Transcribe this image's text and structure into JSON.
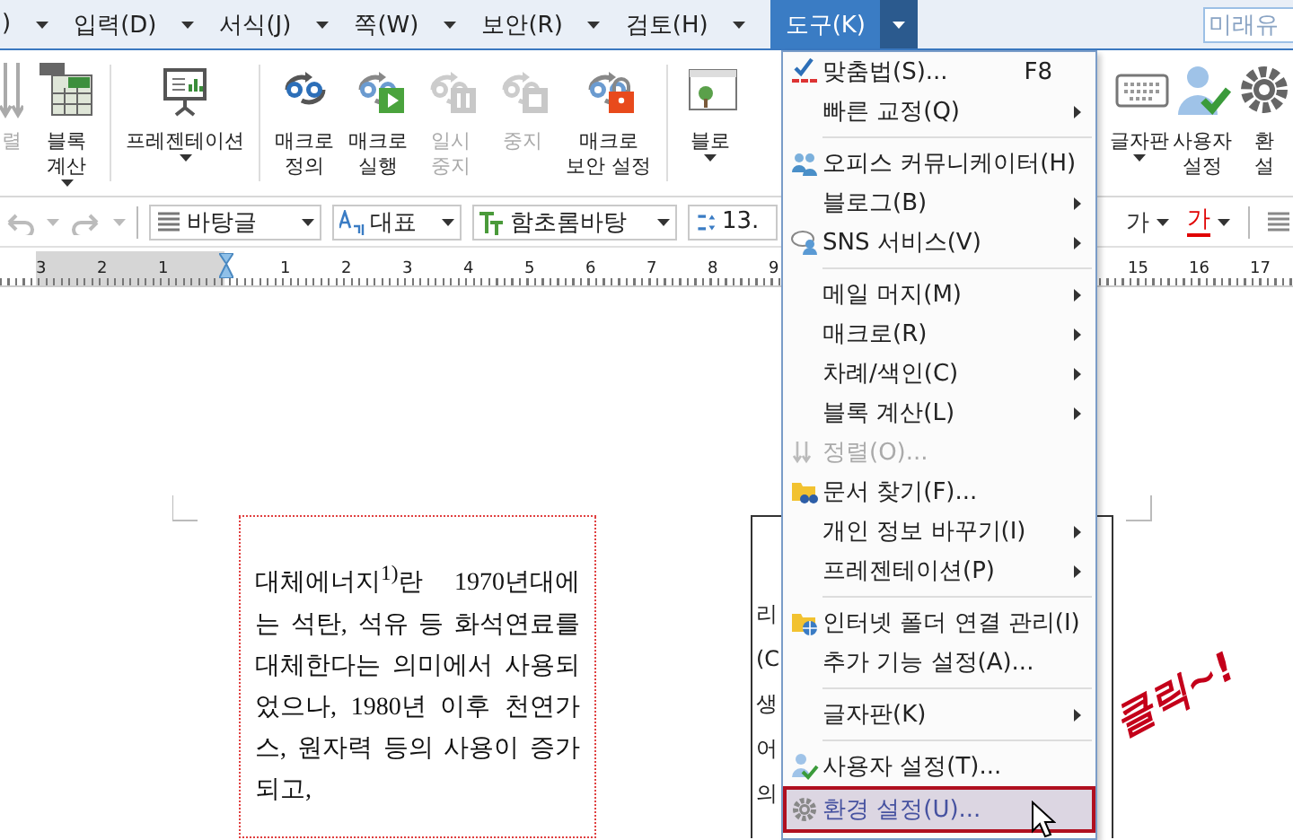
{
  "menubar": {
    "items": [
      {
        "label": ")",
        "selected": false
      },
      {
        "label": "입력(D)",
        "selected": false
      },
      {
        "label": "서식(J)",
        "selected": false
      },
      {
        "label": "쪽(W)",
        "selected": false
      },
      {
        "label": "보안(R)",
        "selected": false
      },
      {
        "label": "검토(H)",
        "selected": false
      },
      {
        "label": "도구(K)",
        "selected": true
      }
    ],
    "search": {
      "value": "미래유"
    }
  },
  "toolbar": {
    "left": [
      {
        "kind": "button",
        "label": "렬",
        "disabled": true,
        "dropdown": false
      },
      {
        "kind": "button",
        "label": "블록\n계산",
        "disabled": false,
        "dropdown": true
      },
      {
        "kind": "separator"
      },
      {
        "kind": "button",
        "label": "프레젠테이션",
        "disabled": false,
        "dropdown": true
      },
      {
        "kind": "separator"
      },
      {
        "kind": "button",
        "label": "매크로\n정의",
        "disabled": false,
        "dropdown": false
      },
      {
        "kind": "button",
        "label": "매크로\n실행",
        "disabled": false,
        "dropdown": false
      },
      {
        "kind": "button",
        "label": "일시\n중지",
        "disabled": true,
        "dropdown": false
      },
      {
        "kind": "button",
        "label": "중지",
        "disabled": true,
        "dropdown": false
      },
      {
        "kind": "button",
        "label": "매크로\n보안 설정",
        "disabled": false,
        "dropdown": false
      },
      {
        "kind": "separator"
      },
      {
        "kind": "button",
        "label": "블로",
        "disabled": false,
        "dropdown": true
      }
    ],
    "right": [
      {
        "kind": "button",
        "label": "글자판",
        "disabled": false,
        "dropdown": true
      },
      {
        "kind": "button",
        "label": "사용자\n설정",
        "disabled": false,
        "dropdown": false
      },
      {
        "kind": "button",
        "label": "환\n설",
        "disabled": false,
        "dropdown": false
      }
    ]
  },
  "format_bar": {
    "style": "바탕글",
    "language": "대표",
    "font": "함초롬바탕",
    "size": "13.",
    "char_buttons": [
      {
        "label": "가",
        "color": "#333333"
      },
      {
        "label": "가",
        "color": "#e00000"
      }
    ]
  },
  "ruler": {
    "left_labels": [
      "3",
      "2",
      "1"
    ],
    "labels": [
      "1",
      "2",
      "3",
      "4",
      "5",
      "6",
      "7",
      "8",
      "9"
    ],
    "right_labels": [
      "15",
      "16",
      "17"
    ]
  },
  "document": {
    "text_box": {
      "text": "대체에너지$^{1)}$란 1970년대에는 석탄, 석유 등 화석연료를 대체한다는 의미에서 사용되었으나, 1980년 이후 천연가스, 원자력 등의 사용이 증가되고,"
    },
    "right_box": {
      "fragments": [
        "리",
        "(C",
        "생",
        "어",
        "의"
      ]
    }
  },
  "tools_menu": {
    "items": [
      {
        "kind": "item",
        "label": "맞춤법(S)...",
        "shortcut": "F8",
        "submenu": false,
        "disabled": false,
        "selected": false
      },
      {
        "kind": "item",
        "label": "빠른 교정(Q)",
        "submenu": true,
        "disabled": false,
        "selected": false
      },
      {
        "kind": "separator"
      },
      {
        "kind": "item",
        "label": "오피스 커뮤니케이터(H)",
        "submenu": false,
        "disabled": false,
        "selected": false
      },
      {
        "kind": "item",
        "label": "블로그(B)",
        "submenu": true,
        "disabled": false,
        "selected": false
      },
      {
        "kind": "item",
        "label": "SNS 서비스(V)",
        "submenu": true,
        "disabled": false,
        "selected": false
      },
      {
        "kind": "separator"
      },
      {
        "kind": "item",
        "label": "메일 머지(M)",
        "submenu": true,
        "disabled": false,
        "selected": false
      },
      {
        "kind": "item",
        "label": "매크로(R)",
        "submenu": true,
        "disabled": false,
        "selected": false
      },
      {
        "kind": "item",
        "label": "차례/색인(C)",
        "submenu": true,
        "disabled": false,
        "selected": false
      },
      {
        "kind": "item",
        "label": "블록 계산(L)",
        "submenu": true,
        "disabled": false,
        "selected": false
      },
      {
        "kind": "item",
        "label": "정렬(O)...",
        "submenu": false,
        "disabled": true,
        "selected": false
      },
      {
        "kind": "item",
        "label": "문서 찾기(F)...",
        "submenu": false,
        "disabled": false,
        "selected": false
      },
      {
        "kind": "item",
        "label": "개인 정보 바꾸기(I)",
        "submenu": true,
        "disabled": false,
        "selected": false
      },
      {
        "kind": "item",
        "label": "프레젠테이션(P)",
        "submenu": true,
        "disabled": false,
        "selected": false
      },
      {
        "kind": "separator"
      },
      {
        "kind": "item",
        "label": "인터넷 폴더 연결 관리(I)",
        "submenu": false,
        "disabled": false,
        "selected": false
      },
      {
        "kind": "item",
        "label": "추가 기능 설정(A)...",
        "submenu": false,
        "disabled": false,
        "selected": false
      },
      {
        "kind": "separator"
      },
      {
        "kind": "item",
        "label": "글자판(K)",
        "submenu": true,
        "disabled": false,
        "selected": false
      },
      {
        "kind": "separator"
      },
      {
        "kind": "item",
        "label": "사용자 설정(T)...",
        "submenu": false,
        "disabled": false,
        "selected": false
      },
      {
        "kind": "item",
        "label": "환경 설정(U)...",
        "submenu": false,
        "disabled": false,
        "selected": true
      }
    ]
  },
  "annotation": {
    "text": "클릭~!"
  }
}
